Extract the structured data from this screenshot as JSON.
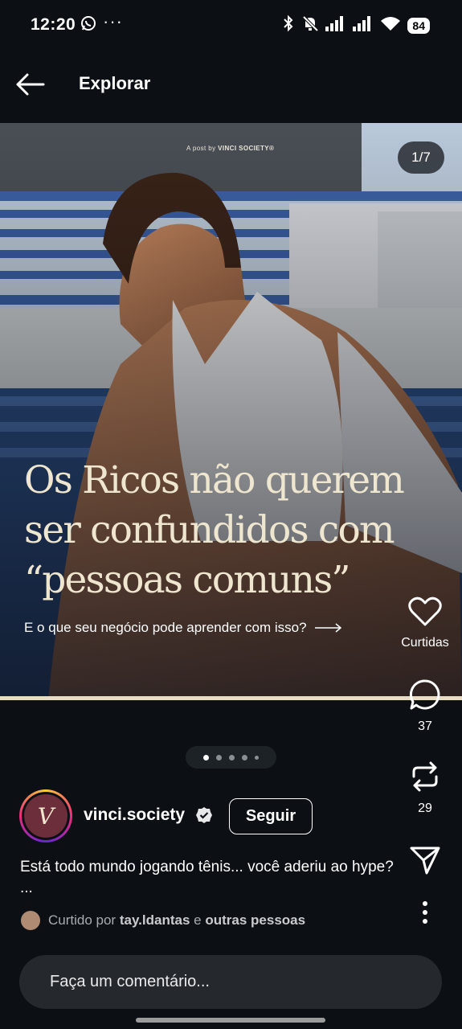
{
  "status_bar": {
    "time": "12:20",
    "battery": "84"
  },
  "header": {
    "title": "Explorar"
  },
  "post": {
    "credit_prefix": "A post by",
    "credit_brand": "VINCI SOCIETY®",
    "counter": "1/7",
    "headline": [
      "Os Ricos não querem",
      "ser confundidos com",
      "“pessoas comuns”"
    ],
    "subline": "E o que seu negócio pode aprender com isso?",
    "current_slide": 1,
    "total_slides": 7
  },
  "actions": {
    "like_label": "Curtidas",
    "comments_count": "37",
    "reposts_count": "29"
  },
  "author": {
    "username": "vinci.society",
    "follow_label": "Seguir",
    "avatar_letter": "V"
  },
  "caption": "Está todo mundo jogando tênis... você aderiu ao hype? ...",
  "liked_by": {
    "prefix": "Curtido por",
    "user": "tay.ldantas",
    "and": "e",
    "others": "outras pessoas"
  },
  "comment_input": {
    "placeholder": "Faça um comentário..."
  },
  "icons": [
    "whatsapp-icon",
    "bluetooth-icon",
    "mute-icon",
    "signal-icon",
    "wifi-icon",
    "back-arrow-icon",
    "heart-icon",
    "comment-icon",
    "repost-icon",
    "share-icon",
    "more-icon",
    "verified-icon"
  ]
}
